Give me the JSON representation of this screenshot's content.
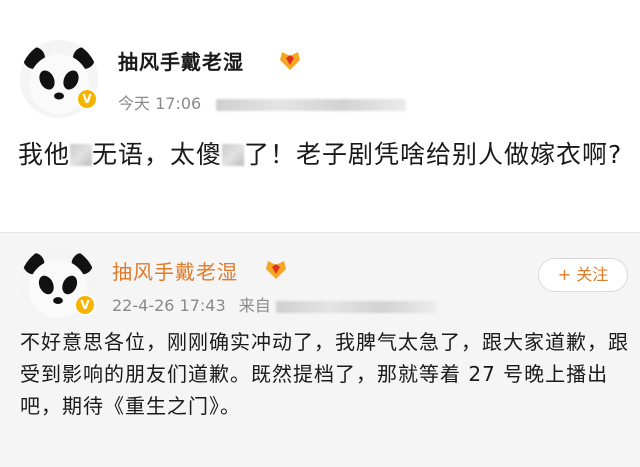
{
  "post": {
    "username": "抽风手戴老湿",
    "time": "今天 17:06",
    "text_part1": "我他",
    "text_part2": "无语，太傻",
    "text_part3": "了！老子剧凭啥给别人做嫁衣啊?"
  },
  "repost": {
    "username": "抽风手戴老湿",
    "time": "22-4-26 17:43",
    "source_prefix": "来自",
    "follow_label": "+ 关注",
    "text": "不好意思各位，刚刚确实冲动了，我脾气太急了，跟大家道歉，跟受到影响的朋友们道歉。既然提档了，那就等着 27 号晚上播出吧，期待《重生之门》。"
  },
  "icons": [
    "panda-avatar-icon",
    "verified-v-icon",
    "medal-badge-icon"
  ],
  "colors": {
    "accent": "#e07b2a",
    "verified": "#f5b400",
    "meta_text": "#8a8a8a"
  }
}
